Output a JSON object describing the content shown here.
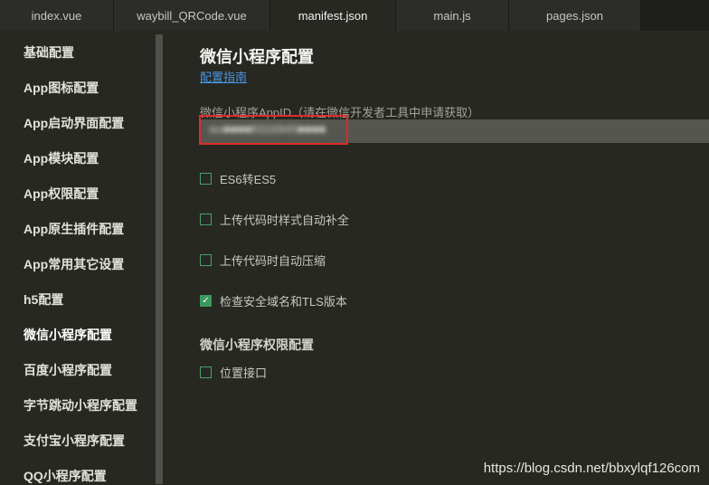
{
  "tabs": [
    {
      "label": "index.vue",
      "active": false
    },
    {
      "label": "waybill_QRCode.vue",
      "active": false
    },
    {
      "label": "manifest.json",
      "active": true
    },
    {
      "label": "main.js",
      "active": false
    },
    {
      "label": "pages.json",
      "active": false
    }
  ],
  "sidebar": {
    "items": [
      {
        "label": "基础配置"
      },
      {
        "label": "App图标配置"
      },
      {
        "label": "App启动界面配置"
      },
      {
        "label": "App模块配置"
      },
      {
        "label": "App权限配置"
      },
      {
        "label": "App原生插件配置"
      },
      {
        "label": "App常用其它设置"
      },
      {
        "label": "h5配置"
      },
      {
        "label": "微信小程序配置",
        "active": true
      },
      {
        "label": "百度小程序配置"
      },
      {
        "label": "字节跳动小程序配置"
      },
      {
        "label": "支付宝小程序配置"
      },
      {
        "label": "QQ小程序配置"
      }
    ]
  },
  "main": {
    "title": "微信小程序配置",
    "guide_link": "配置指南",
    "appid_label": "微信小程序AppID（请在微信开发者工具中申请获取）",
    "appid_value": "wx■■■■8316945■■■■",
    "options": [
      {
        "label": "ES6转ES5",
        "checked": false
      },
      {
        "label": "上传代码时样式自动补全",
        "checked": false
      },
      {
        "label": "上传代码时自动压缩",
        "checked": false
      },
      {
        "label": "检查安全域名和TLS版本",
        "checked": true
      }
    ],
    "permissions_title": "微信小程序权限配置",
    "permission_options": [
      {
        "label": "位置接口",
        "checked": false
      }
    ]
  },
  "watermark": "https://blog.csdn.net/bbxylqf126com",
  "colors": {
    "background": "#272822",
    "link": "#4b95e4",
    "checkbox_checked": "#3a9a5e",
    "highlight": "#e02a2a"
  }
}
